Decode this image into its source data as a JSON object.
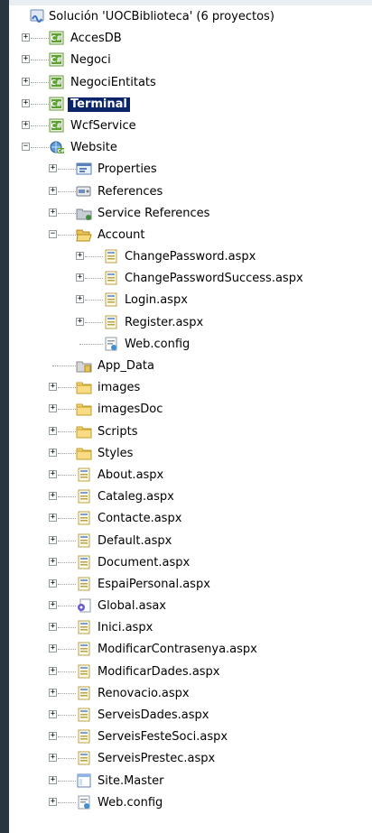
{
  "solution": {
    "label": "Solución 'UOCBiblioteca' (6 proyectos)",
    "icon": "solution-icon"
  },
  "projects": [
    {
      "label": "AccesDB",
      "icon": "csharp-project-icon"
    },
    {
      "label": "Negoci",
      "icon": "csharp-project-icon"
    },
    {
      "label": "NegociEntitats",
      "icon": "csharp-project-icon"
    },
    {
      "label": "Terminal",
      "icon": "csharp-project-icon",
      "selected": true
    },
    {
      "label": "WcfService",
      "icon": "csharp-project-icon"
    },
    {
      "label": "Website",
      "icon": "website-project-icon"
    }
  ],
  "website_items": [
    {
      "label": "Properties",
      "icon": "properties-icon"
    },
    {
      "label": "References",
      "icon": "references-icon"
    },
    {
      "label": "Service References",
      "icon": "service-references-icon"
    },
    {
      "label": "Account",
      "icon": "open-folder-icon"
    },
    {
      "label": "App_Data",
      "icon": "app-data-folder-icon"
    },
    {
      "label": "images",
      "icon": "folder-icon"
    },
    {
      "label": "imagesDoc",
      "icon": "folder-icon"
    },
    {
      "label": "Scripts",
      "icon": "folder-icon"
    },
    {
      "label": "Styles",
      "icon": "folder-icon"
    },
    {
      "label": "About.aspx",
      "icon": "aspx-file-icon"
    },
    {
      "label": "Cataleg.aspx",
      "icon": "aspx-file-icon"
    },
    {
      "label": "Contacte.aspx",
      "icon": "aspx-file-icon"
    },
    {
      "label": "Default.aspx",
      "icon": "aspx-file-icon"
    },
    {
      "label": "Document.aspx",
      "icon": "aspx-file-icon"
    },
    {
      "label": "EspaiPersonal.aspx",
      "icon": "aspx-file-icon"
    },
    {
      "label": "Global.asax",
      "icon": "asax-file-icon"
    },
    {
      "label": "Inici.aspx",
      "icon": "aspx-file-icon"
    },
    {
      "label": "ModificarContrasenya.aspx",
      "icon": "aspx-file-icon"
    },
    {
      "label": "ModificarDades.aspx",
      "icon": "aspx-file-icon"
    },
    {
      "label": "Renovacio.aspx",
      "icon": "aspx-file-icon"
    },
    {
      "label": "ServeisDades.aspx",
      "icon": "aspx-file-icon"
    },
    {
      "label": "ServeisFesteSoci.aspx",
      "icon": "aspx-file-icon"
    },
    {
      "label": "ServeisPrestec.aspx",
      "icon": "aspx-file-icon"
    },
    {
      "label": "Site.Master",
      "icon": "master-page-icon"
    },
    {
      "label": "Web.config",
      "icon": "config-file-icon"
    }
  ],
  "account_items": [
    {
      "label": "ChangePassword.aspx",
      "icon": "aspx-file-icon"
    },
    {
      "label": "ChangePasswordSuccess.aspx",
      "icon": "aspx-file-icon"
    },
    {
      "label": "Login.aspx",
      "icon": "aspx-file-icon"
    },
    {
      "label": "Register.aspx",
      "icon": "aspx-file-icon"
    },
    {
      "label": "Web.config",
      "icon": "config-file-icon"
    }
  ],
  "colors": {
    "selection_bg": "#0a246a",
    "selection_fg": "#ffffff",
    "folder": "#f5d26b",
    "csharp": "#4c9a2a",
    "left_bar": "#28363f"
  }
}
